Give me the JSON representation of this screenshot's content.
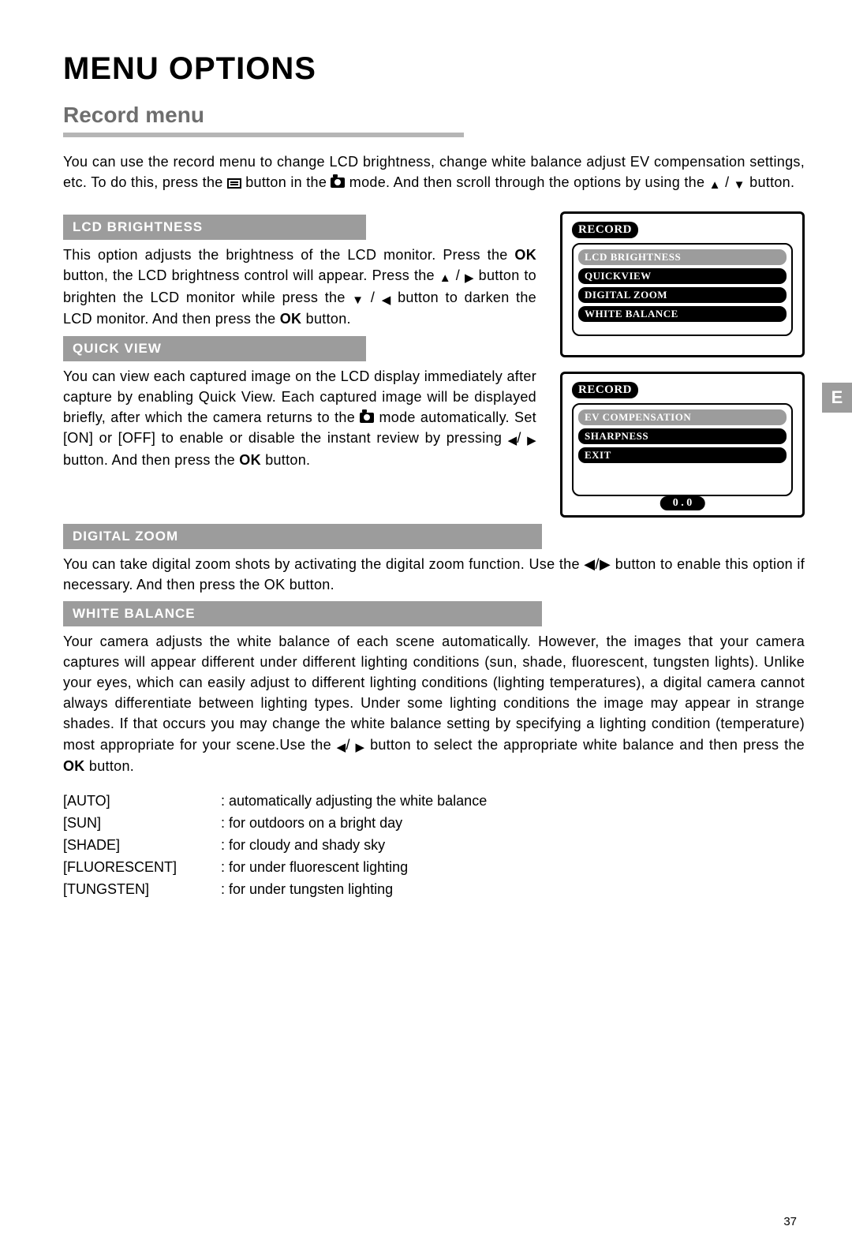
{
  "page": {
    "side_tab": "E",
    "title": "MENU OPTIONS",
    "subtitle": "Record menu",
    "page_number": "37",
    "intro_1": "You can use the record menu to change LCD brightness, change white balance adjust EV compensation settings, etc. To do this, press the ",
    "intro_2": " button in the ",
    "intro_3": " mode. And then scroll through the options by using the ",
    "intro_4": " button."
  },
  "sections": {
    "lcd": {
      "header": "LCD BRIGHTNESS",
      "p1": "This option adjusts the brightness of the LCD monitor. Press the ",
      "ok1": "OK",
      "p2": " button, the LCD bright­ness control will appear. Press the ",
      "p3": " but­ton to brighten the LCD monitor while press the ",
      "p4": " button to darken the LCD monitor. And then press the ",
      "ok2": "OK",
      "p5": " button."
    },
    "qv": {
      "header": "QUICK VIEW",
      "p1": "You can view each captured image on the LCD display immediately after capture by enabling Quick View. Each captured image will be dis­played briefly, after which the camera returns to the ",
      "p2": " mode automatically. Set [ON] or [OFF] to enable or disable the instant review by press­ing ",
      "p3": " button. And then press the ",
      "ok": "OK",
      "p4": " button."
    },
    "dz": {
      "header": "DIGITAL ZOOM",
      "body": "You can take digital zoom shots by activating the digital zoom function. Use the ◀/▶ button to enable this option if necessary. And then press the OK button."
    },
    "wb": {
      "header": "WHITE BALANCE",
      "p1": "Your camera adjusts the white balance of each scene automatically.  However, the images that your camera captures will appear different under different light­ing conditions (sun, shade, fluorescent, tungsten lights).  Unlike your eyes, which can easily adjust to different lighting conditions (lighting temperatures), a digital camera cannot always differentiate between lighting types.  Under some lighting conditions the image may appear in strange shades.  If that occurs you may change the white balance setting by specifying a lighting condition (temperature) most appropriate for your scene.Use the ",
      "p2": " button to select the appropriate white balance and then press the ",
      "ok": "OK",
      "p3": " button.",
      "rows": [
        {
          "k": "[AUTO]",
          "v": ": automatically adjusting the white balance"
        },
        {
          "k": "[SUN]",
          "v": ": for outdoors on a bright day"
        },
        {
          "k": "[SHADE]",
          "v": ": for cloudy and shady sky"
        },
        {
          "k": "[FLUORESCENT]",
          "v": ": for under fluorescent lighting"
        },
        {
          "k": "[TUNGSTEN]",
          "v": ": for under tungsten lighting"
        }
      ]
    }
  },
  "screens": {
    "a": {
      "tab": "RECORD",
      "items": [
        "LCD  BRIGHTNESS",
        "QUICKVIEW",
        "DIGITAL  ZOOM",
        "WHITE BALANCE"
      ],
      "selected_index": 0
    },
    "b": {
      "tab": "RECORD",
      "items": [
        "EV  COMPENSATION",
        "SHARPNESS",
        "EXIT"
      ],
      "selected_index": 0,
      "footer": "0 . 0"
    }
  },
  "glyphs": {
    "up": "▲",
    "down": "▼",
    "left": "◀",
    "right": "▶",
    "slash": " / "
  }
}
